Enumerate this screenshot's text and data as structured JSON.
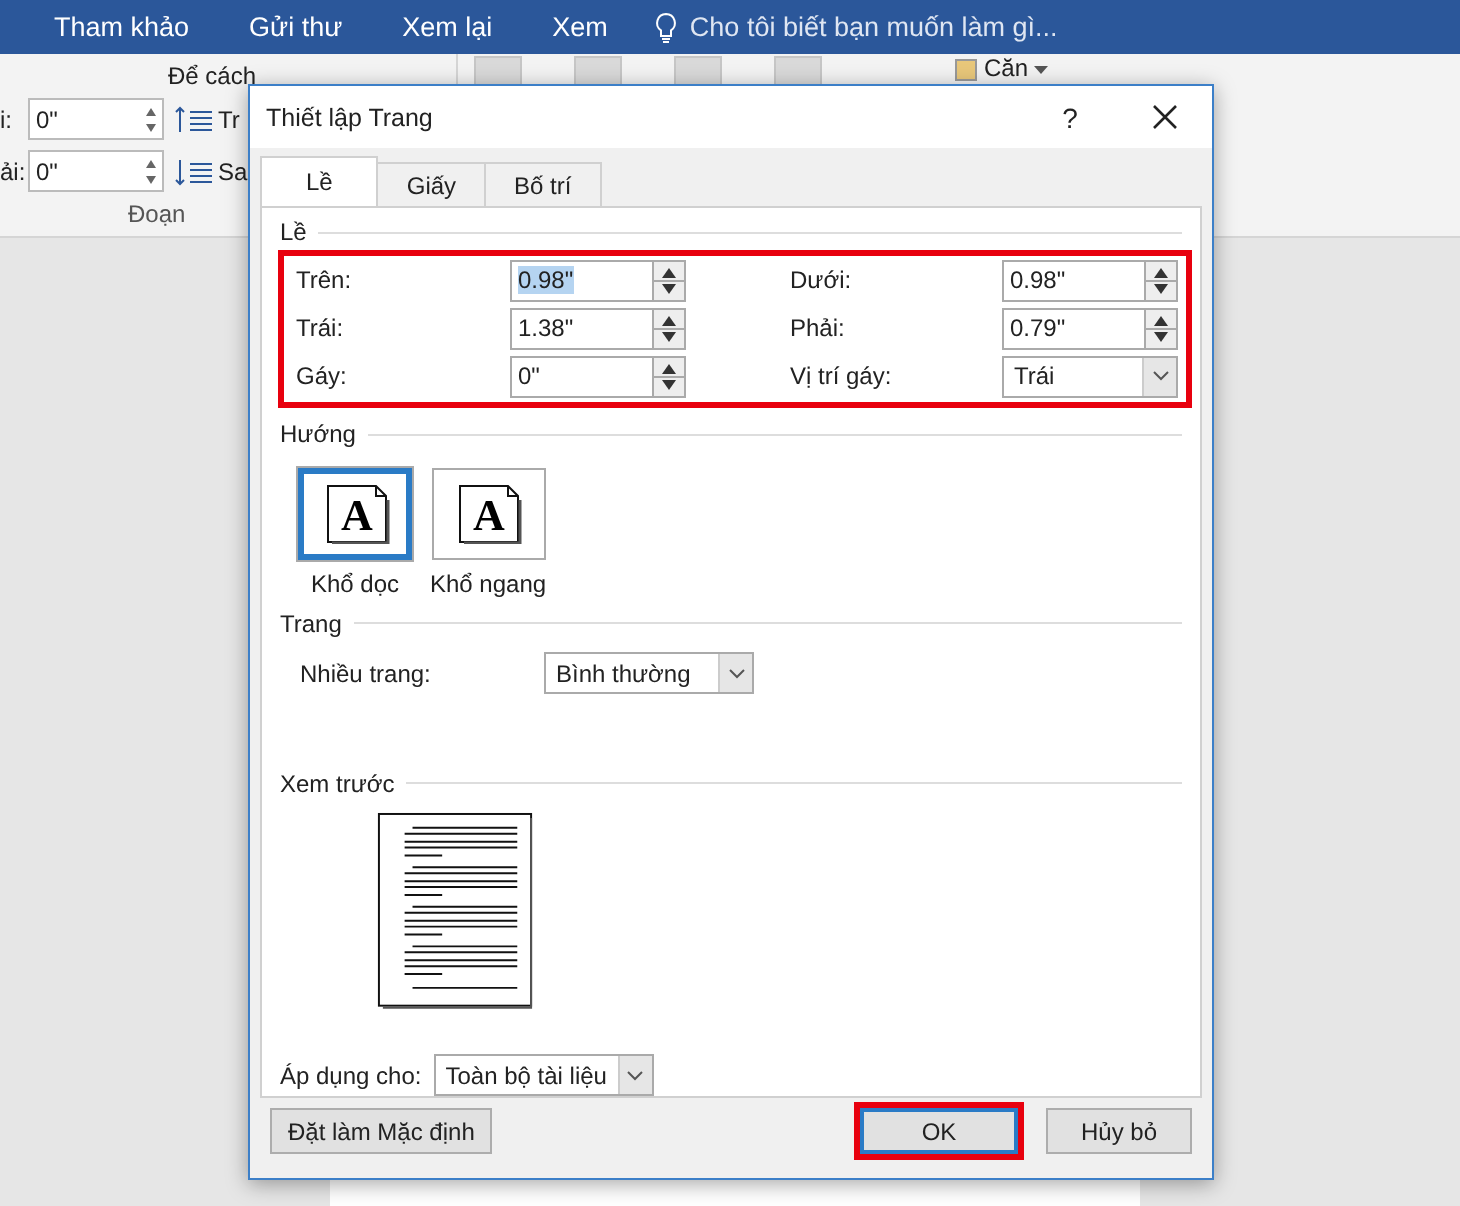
{
  "ribbon": {
    "tabs": [
      {
        "label": "Tham khảo"
      },
      {
        "label": "Gửi thư"
      },
      {
        "label": "Xem lại"
      },
      {
        "label": "Xem"
      }
    ],
    "tell_me": "Cho tôi biết bạn muốn làm gì...",
    "spacing_title": "Để cách",
    "fields": [
      {
        "label": "i:",
        "value": "0\"",
        "button": "Tr"
      },
      {
        "label": "ải:",
        "value": "0\"",
        "button": "Sa"
      }
    ],
    "group_label": "Đoạn",
    "align_button": "Căn"
  },
  "dialog": {
    "title": "Thiết lập Trang",
    "help": "?",
    "tabs": [
      {
        "label": "Lề",
        "selected": true
      },
      {
        "label": "Giấy",
        "selected": false
      },
      {
        "label": "Bố trí",
        "selected": false
      }
    ],
    "margins": {
      "title": "Lề",
      "outlined": true,
      "fields": [
        {
          "kind": "spin",
          "label": "Trên:",
          "value": "0.98\"",
          "highlighted": true
        },
        {
          "kind": "spin",
          "label": "Dưới:",
          "value": "0.98\"",
          "highlighted": false
        },
        {
          "kind": "spin",
          "label": "Trái:",
          "value": "1.38\"",
          "highlighted": false
        },
        {
          "kind": "spin",
          "label": "Phải:",
          "value": "0.79\"",
          "highlighted": false
        },
        {
          "kind": "spin",
          "label": "Gáy:",
          "value": "0\"",
          "highlighted": false
        },
        {
          "kind": "combo",
          "label": "Vị trí gáy:",
          "value": "Trái",
          "highlighted": false
        }
      ]
    },
    "orientation": {
      "title": "Hướng",
      "options": [
        {
          "label": "Khổ dọc",
          "glyph": "A",
          "selected": true
        },
        {
          "label": "Khổ ngang",
          "glyph": "A",
          "selected": false
        }
      ]
    },
    "pages": {
      "title": "Trang",
      "label": "Nhiều trang:",
      "value": "Bình thường"
    },
    "preview": {
      "title": "Xem trước"
    },
    "apply_to": {
      "label": "Áp dụng cho:",
      "value": "Toàn bộ tài liệu"
    },
    "buttons": [
      {
        "label": "Đặt làm Mặc định",
        "default": false,
        "outlined": false
      },
      {
        "label": "OK",
        "default": true,
        "outlined": true
      },
      {
        "label": "Hủy bỏ",
        "default": false,
        "outlined": false
      }
    ]
  }
}
